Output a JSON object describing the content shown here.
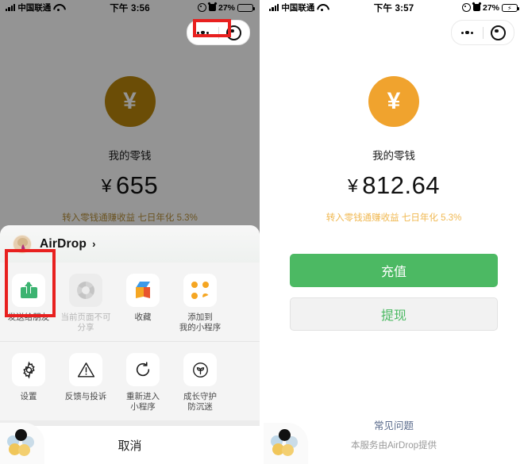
{
  "left_panel": {
    "status_bar": {
      "carrier": "中国联通",
      "time": "下午 3:56",
      "battery_percent": "27%",
      "charging": false
    },
    "capsule": {
      "menu_icon": "more-dots-icon",
      "target_icon": "target-icon"
    },
    "wallet": {
      "coin_symbol": "¥",
      "coin_color": "#b8860b",
      "label": "我的零钱",
      "currency": "¥",
      "amount": "655",
      "rate_text": "转入零钱通赚收益 七日年化 5.3%",
      "rate_color": "#b8913c"
    },
    "share_sheet": {
      "airdrop_title": "AirDrop",
      "chevron": "›",
      "row1": [
        {
          "label": "发送给朋友",
          "icon": "send-to-friend-icon",
          "disabled": false,
          "highlighted": true
        },
        {
          "label": "当前页面不可\n分享",
          "icon": "shutter-icon",
          "disabled": true,
          "highlighted": false
        },
        {
          "label": "收藏",
          "icon": "favorite-box-icon",
          "disabled": false,
          "highlighted": false
        },
        {
          "label": "添加到\n我的小程序",
          "icon": "add-miniprogram-icon",
          "disabled": false,
          "highlighted": false
        }
      ],
      "row2": [
        {
          "label": "设置",
          "icon": "gear-icon"
        },
        {
          "label": "反馈与投诉",
          "icon": "warning-triangle-icon"
        },
        {
          "label": "重新进入\n小程序",
          "icon": "refresh-icon"
        },
        {
          "label": "成长守护\n防沉迷",
          "icon": "plant-shield-icon"
        }
      ],
      "cancel_label": "取消"
    },
    "watermark_icon": "pinwheel-watermark-icon"
  },
  "right_panel": {
    "status_bar": {
      "carrier": "中国联通",
      "time": "下午 3:57",
      "battery_percent": "27%",
      "charging": true
    },
    "capsule": {
      "menu_icon": "more-dots-icon",
      "target_icon": "target-icon"
    },
    "wallet": {
      "coin_symbol": "¥",
      "coin_color": "#f0a32e",
      "label": "我的零钱",
      "currency": "¥",
      "amount": "812.64",
      "rate_text": "转入零钱通赚收益 七日年化 5.3%",
      "rate_color": "#f0b851"
    },
    "buttons": {
      "recharge_label": "充值",
      "withdraw_label": "提现",
      "primary_color": "#4cb963"
    },
    "footer": {
      "faq_label": "常见问题",
      "provider_text": "本服务由AirDrop提供"
    },
    "watermark_icon": "pinwheel-watermark-icon"
  },
  "annotations": {
    "box_color": "#e8201f",
    "menu_box_target": "more-dots-icon",
    "share_box_target": "发送给朋友"
  }
}
